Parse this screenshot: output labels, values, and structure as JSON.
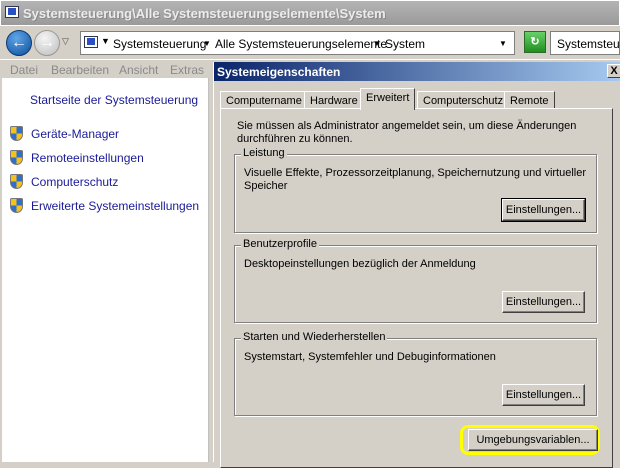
{
  "window": {
    "title": "Systemsteuerung\\Alle Systemsteuerungselemente\\System"
  },
  "address": {
    "crumbs": [
      "Systemsteuerung",
      "Alle Systemsteuerungselemente",
      "System"
    ],
    "search": "Systemsteuerung durchsuchen"
  },
  "menu": [
    "Datei",
    "Bearbeiten",
    "Ansicht",
    "Extras"
  ],
  "sidebar": {
    "home": "Startseite der Systemsteuerung",
    "items": [
      "Geräte-Manager",
      "Remoteeinstellungen",
      "Computerschutz",
      "Erweiterte Systemeinstellungen"
    ]
  },
  "dialog": {
    "title": "Systemeigenschaften",
    "close": "X",
    "tabs": [
      "Computername",
      "Hardware",
      "Erweitert",
      "Computerschutz",
      "Remote"
    ],
    "active_tab": "Erweitert",
    "notice": "Sie müssen als Administrator angemeldet sein, um diese Änderungen durchführen zu können.",
    "groups": [
      {
        "title": "Leistung",
        "desc": "Visuelle Effekte, Prozessorzeitplanung, Speichernutzung und virtueller Speicher",
        "button": "Einstellungen..."
      },
      {
        "title": "Benutzerprofile",
        "desc": "Desktopeinstellungen bezüglich der Anmeldung",
        "button": "Einstellungen..."
      },
      {
        "title": "Starten und Wiederherstellen",
        "desc": "Systemstart, Systemfehler und Debuginformationen",
        "button": "Einstellungen..."
      }
    ],
    "env_button": "Umgebungsvariablen...",
    "highlight_color": "#ffff00"
  }
}
